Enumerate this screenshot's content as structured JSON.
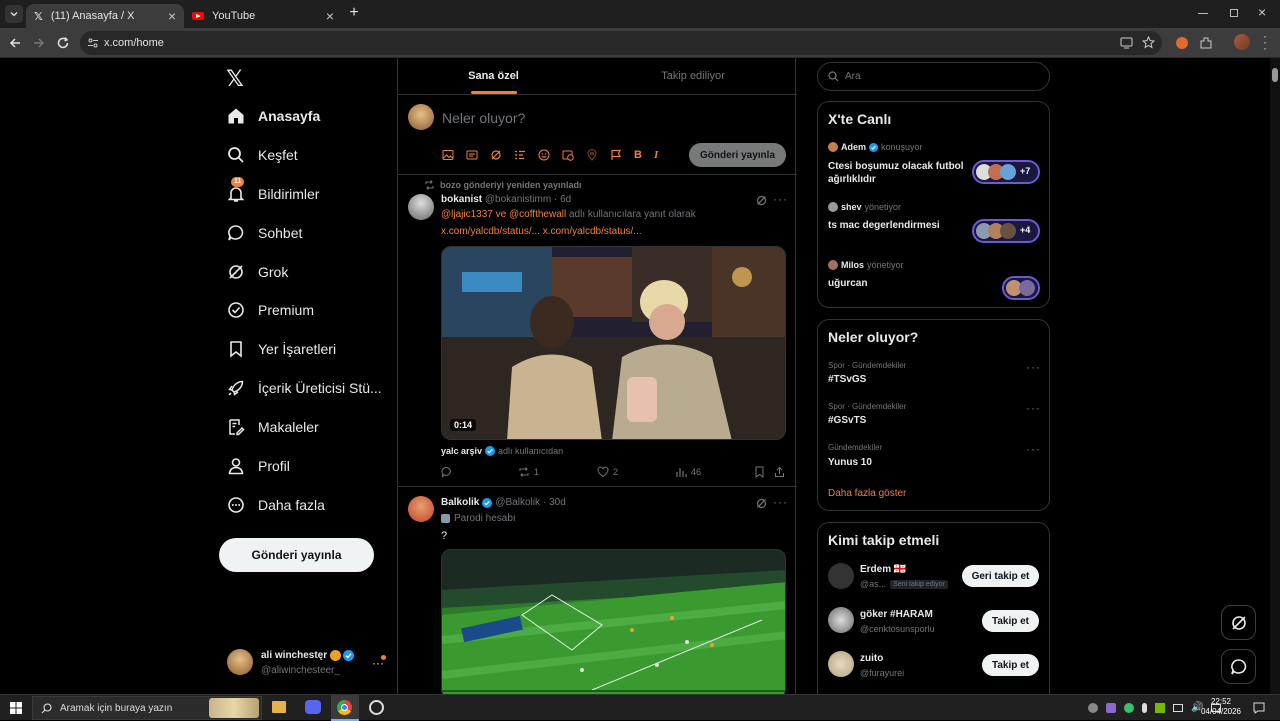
{
  "browser": {
    "tabs": [
      {
        "title": "(11) Anasayfa / X"
      },
      {
        "title": "YouTube"
      }
    ],
    "url": "x.com/home"
  },
  "sidebar": {
    "items": [
      {
        "label": "Anasayfa"
      },
      {
        "label": "Keşfet"
      },
      {
        "label": "Bildirimler",
        "badge": "11"
      },
      {
        "label": "Sohbet"
      },
      {
        "label": "Grok"
      },
      {
        "label": "Premium"
      },
      {
        "label": "Yer İşaretleri"
      },
      {
        "label": "İçerik Üreticisi Stü..."
      },
      {
        "label": "Makaleler"
      },
      {
        "label": "Profil"
      },
      {
        "label": "Daha fazla"
      }
    ],
    "post_button": "Gönderi yayınla",
    "account": {
      "name": "ali winchestęr",
      "handle": "@aliwinchesteer_"
    }
  },
  "feed": {
    "tabs": [
      "Sana özel",
      "Takip ediliyor"
    ],
    "composer": {
      "placeholder": "Neler oluyor?",
      "post_button": "Gönderi yayınla"
    },
    "posts": [
      {
        "repost_note": "bozo gönderiyi yeniden yayınladı",
        "name": "bokanist",
        "handle": "@bokanistimm",
        "time": "· 6d",
        "reply_to_a": "@ljajic1337",
        "reply_to_join": "ve",
        "reply_to_b": "@coffthewall",
        "reply_suffix": "adlı kullanıcılara yanıt olarak",
        "link_1": "x.com/yalcdb/status/...",
        "link_2": "x.com/yalcdb/status/...",
        "video_duration": "0:14",
        "source_name": "yalc arşiv",
        "source_suffix": "adlı kullanıcıdan",
        "reposts": "1",
        "likes": "2",
        "views": "46"
      },
      {
        "name": "Balkolik",
        "handle": "@Balkolik",
        "time": "· 30d",
        "badge": "Parodi hesabı",
        "text": "?"
      }
    ]
  },
  "right": {
    "search_placeholder": "Ara",
    "live": {
      "title": "X'te Canlı",
      "items": [
        {
          "host": "Adem",
          "role": "konuşuyor",
          "title": "Ctesi boşumuz olacak futbol ağırlıklıdır",
          "count": "+7"
        },
        {
          "host": "shev",
          "role": "yönetiyor",
          "title": "ts mac degerlendirmesi",
          "count": "+4"
        },
        {
          "host": "Milos",
          "role": "yönetiyor",
          "title": "uğurcan",
          "count": ""
        }
      ]
    },
    "trends": {
      "title": "Neler oluyor?",
      "items": [
        {
          "context": "Spor · Gündemdekiler",
          "name": "#TSvGS"
        },
        {
          "context": "Spor · Gündemdekiler",
          "name": "#GSvTS"
        },
        {
          "context": "Gündemdekiler",
          "name": "Yunus 10"
        }
      ],
      "more": "Daha fazla göster"
    },
    "who_to_follow": {
      "title": "Kimi takip etmeli",
      "items": [
        {
          "name": "Erdem 🇬🇪",
          "handle": "@as...",
          "tag": "Seni takip ediyor",
          "button": "Geri takip et"
        },
        {
          "name": "göker #HARAM",
          "handle": "@cenktosunsporlu",
          "tag": "",
          "button": "Takip et"
        },
        {
          "name": "zuito",
          "handle": "@furayurei",
          "tag": "",
          "button": "Takip et"
        }
      ]
    }
  },
  "taskbar": {
    "search_placeholder": "Aramak için buraya yazın",
    "time": "22:52",
    "date": "04/04/2026"
  },
  "colors": {
    "accent": "#f0803c",
    "verified": "#1d9bf0",
    "background": "#000000"
  }
}
